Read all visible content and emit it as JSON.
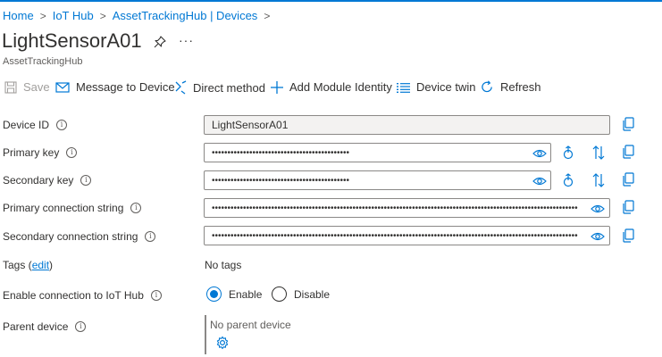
{
  "breadcrumb": {
    "items": [
      "Home",
      "IoT Hub",
      "AssetTrackingHub | Devices"
    ],
    "separator": ">"
  },
  "header": {
    "title": "LightSensorA01",
    "subtitle": "AssetTrackingHub",
    "more_label": "···"
  },
  "toolbar": {
    "save": "Save",
    "message": "Message to Device",
    "direct_method": "Direct method",
    "add_module": "Add Module Identity",
    "device_twin": "Device twin",
    "refresh": "Refresh"
  },
  "fields": {
    "device_id_label": "Device ID",
    "device_id_value": "LightSensorA01",
    "primary_key_label": "Primary key",
    "primary_key_value": "••••••••••••••••••••••••••••••••••••••••••••",
    "secondary_key_label": "Secondary key",
    "secondary_key_value": "••••••••••••••••••••••••••••••••••••••••••••",
    "primary_conn_label": "Primary connection string",
    "primary_conn_value": "•••••••••••••••••••••••••••••••••••••••••••••••••••••••••••••••••••••••••••••••••••••••••••••••••••••••••••••••••••••••••...",
    "secondary_conn_label": "Secondary connection string",
    "secondary_conn_value": "•••••••••••••••••••••••••••••••••••••••••••••••••••••••••••••••••••••••••••••••••••••••••••••••••••••••••••••••••••••••••••..."
  },
  "tags": {
    "label_prefix": "Tags (",
    "edit_link": "edit",
    "label_suffix": ")",
    "value": "No tags"
  },
  "connection": {
    "label": "Enable connection to IoT Hub",
    "enable": "Enable",
    "disable": "Disable",
    "selected": "Enable"
  },
  "parent": {
    "label": "Parent device",
    "value": "No parent device"
  },
  "colors": {
    "accent": "#0078d4",
    "text": "#323130",
    "muted": "#605e5c"
  }
}
